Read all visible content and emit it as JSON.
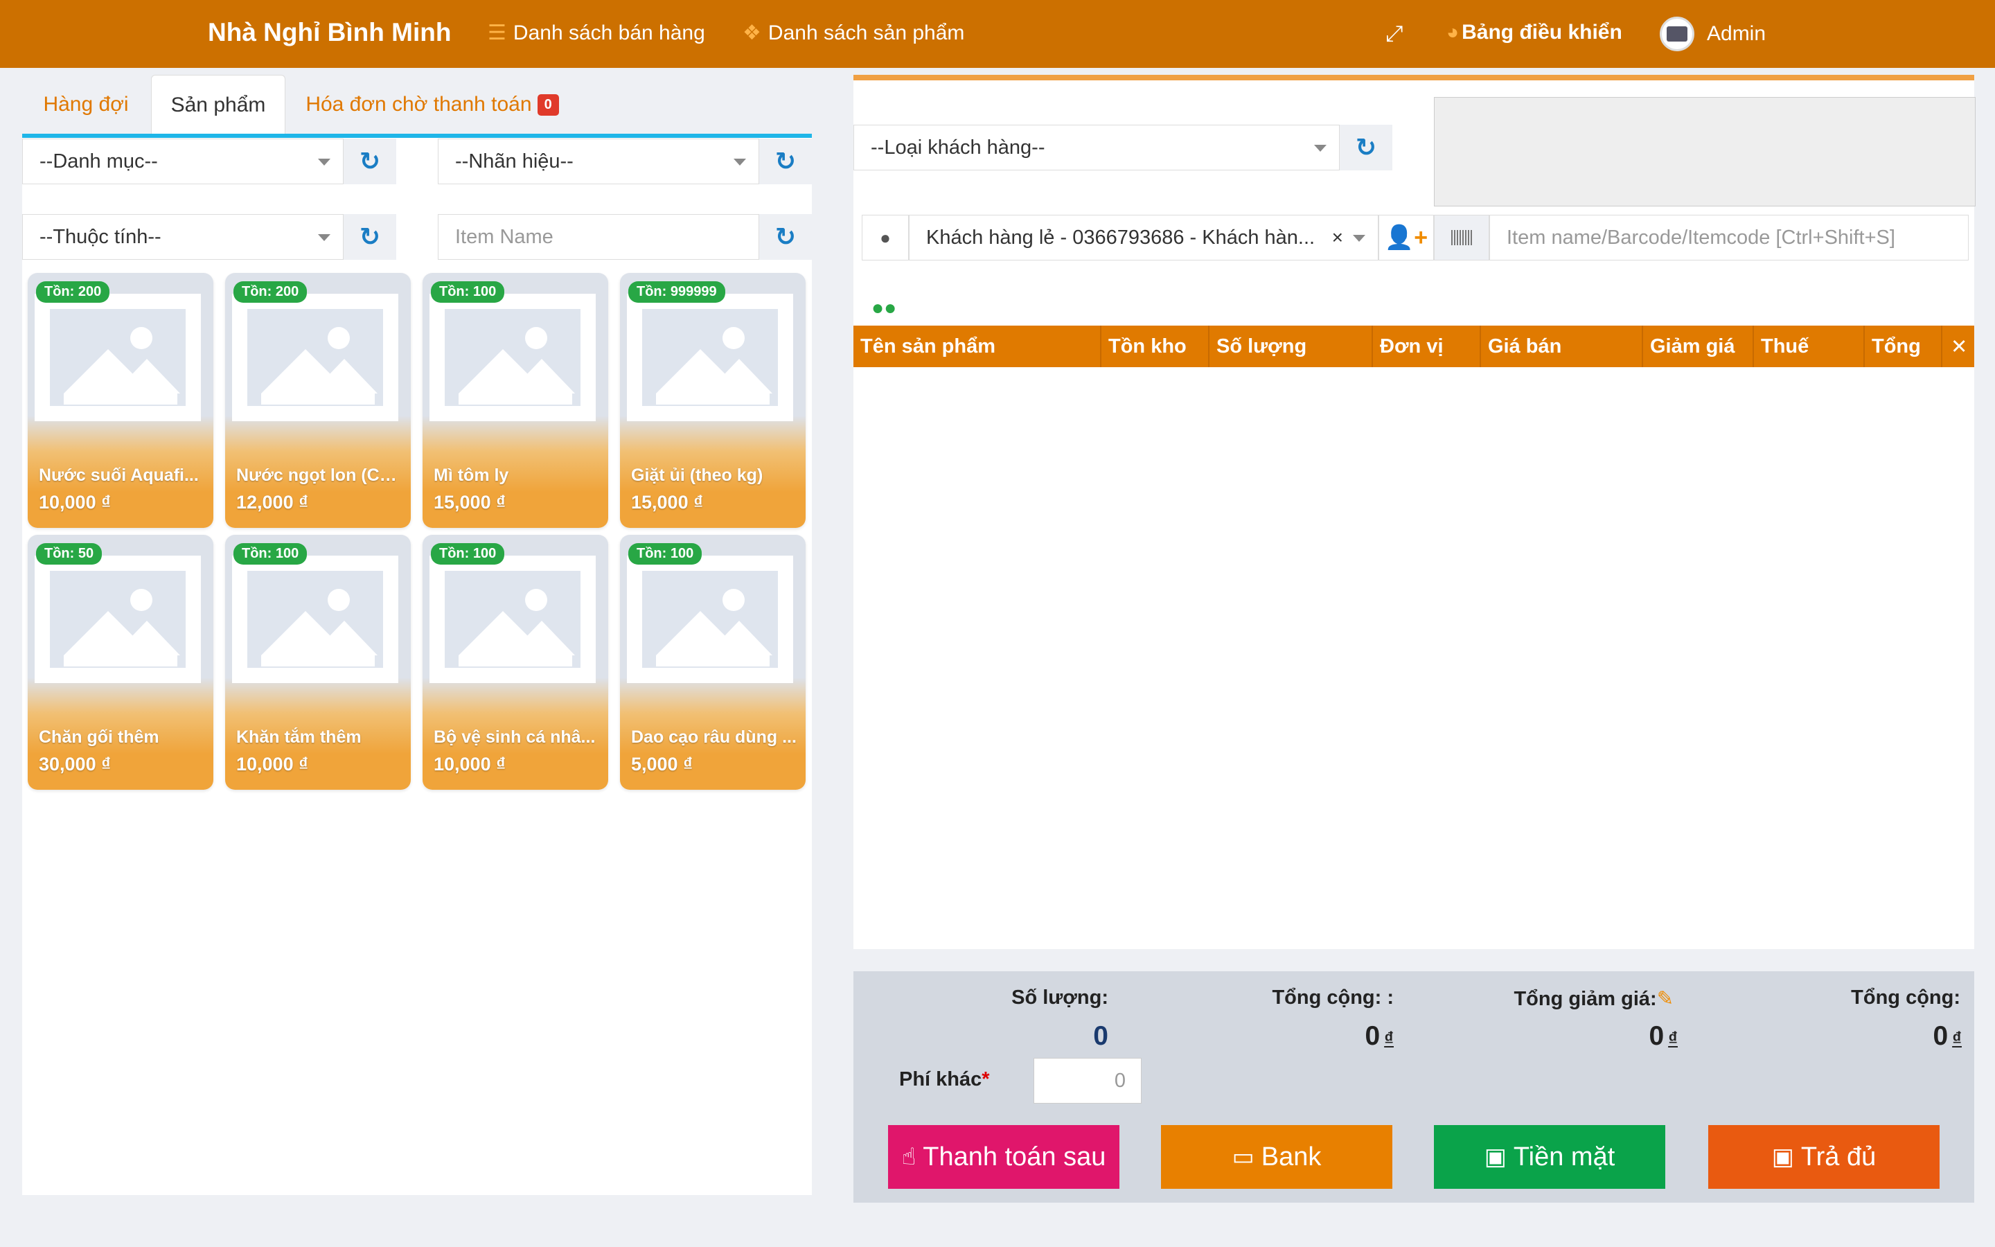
{
  "header": {
    "brand": "Nhà Nghỉ Bình Minh",
    "nav": [
      {
        "label": "Danh sách bán hàng",
        "icon": "list-icon"
      },
      {
        "label": "Danh sách sản phẩm",
        "icon": "cubes-icon"
      }
    ],
    "dashboard_label": "Bảng điều khiển",
    "user": "Admin"
  },
  "tabs": {
    "queue": "Hàng đợi",
    "products": "Sản phẩm",
    "pending": "Hóa đơn chờ thanh toán",
    "pending_count": "0"
  },
  "filters": {
    "category": "--Danh mục--",
    "brand": "--Nhãn hiệu--",
    "attribute": "--Thuộc tính--",
    "item_name_placeholder": "Item Name"
  },
  "products": [
    {
      "stock": "Tồn: 200",
      "name": "Nước suối Aquafi...",
      "price": "10,000 ₫"
    },
    {
      "stock": "Tồn: 200",
      "name": "Nước ngọt lon (Co...",
      "price": "12,000 ₫"
    },
    {
      "stock": "Tồn: 100",
      "name": "Mì tôm ly",
      "price": "15,000 ₫"
    },
    {
      "stock": "Tồn: 999999",
      "name": "Giặt ủi (theo kg)",
      "price": "15,000 ₫"
    },
    {
      "stock": "Tồn: 50",
      "name": "Chăn gối thêm",
      "price": "30,000 ₫"
    },
    {
      "stock": "Tồn: 100",
      "name": "Khăn tắm thêm",
      "price": "10,000 ₫"
    },
    {
      "stock": "Tồn: 100",
      "name": "Bộ vệ sinh cá nhâ...",
      "price": "10,000 ₫"
    },
    {
      "stock": "Tồn: 100",
      "name": "Dao cạo râu dùng ...",
      "price": "5,000 ₫"
    }
  ],
  "customer": {
    "type_placeholder": "--Loại khách hàng--",
    "selected": "Khách hàng lẻ - 0366793686 - Khách hàn...",
    "search_placeholder": "Item name/Barcode/Itemcode [Ctrl+Shift+S]"
  },
  "table": {
    "headers": [
      "Tên sản phẩm",
      "Tồn kho",
      "Số lượng",
      "Đơn vị",
      "Giá bán",
      "Giảm giá",
      "Thuế",
      "Tổng",
      "✕"
    ]
  },
  "summary": {
    "qty_label": "Số lượng:",
    "qty_value": "0",
    "subtotal_label": "Tổng cộng: :",
    "subtotal_value": "0",
    "discount_label": "Tổng giảm giá:",
    "discount_value": "0",
    "total_label": "Tổng cộng:",
    "total_value": "0",
    "currency": "₫",
    "other_fee_label": "Phí khác",
    "other_fee_placeholder": "0"
  },
  "buttons": {
    "pay_later": "Thanh toán sau",
    "bank": "Bank",
    "cash": "Tiền mặt",
    "full": "Trả đủ"
  },
  "colors": {
    "header": "#cc7000",
    "accent": "#e07a00",
    "pay_later": "#e0166b",
    "bank": "#e88000",
    "cash": "#0aa34a",
    "full": "#e95a10"
  }
}
